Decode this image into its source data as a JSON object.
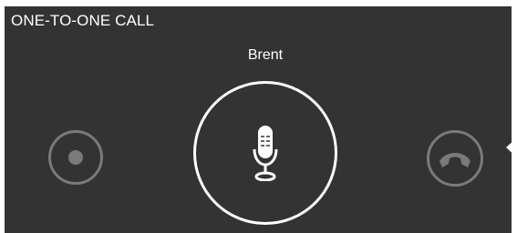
{
  "call": {
    "title": "ONE-TO-ONE CALL",
    "caller_name": "Brent"
  },
  "icons": {
    "record": "record-icon",
    "microphone": "microphone-icon",
    "hangup": "hang-up-phone-icon",
    "collapse": "collapse-arrow-icon"
  },
  "colors": {
    "panel_background": "#333333",
    "text": "#ffffff",
    "muted_icon": "#7a7a7a",
    "active_ring": "#ffffff"
  }
}
